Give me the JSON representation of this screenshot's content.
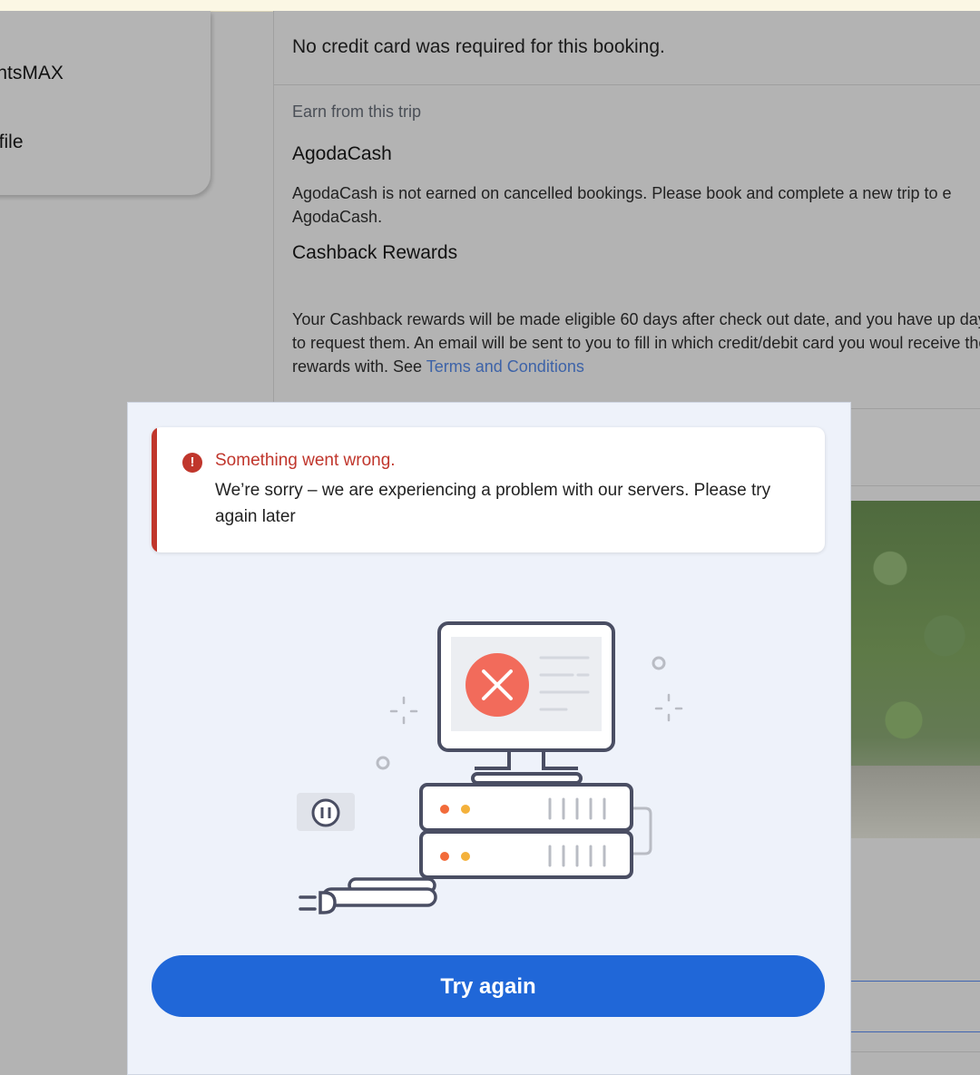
{
  "sidebar": {
    "items": [
      {
        "label": "ointsMAX"
      },
      {
        "label": "rofile"
      }
    ]
  },
  "booking": {
    "credit_card_note": "No credit card was required for this booking.",
    "earn_label": "Earn from this trip",
    "agodacash": {
      "heading": "AgodaCash",
      "text": "AgodaCash is not earned on cancelled bookings. Please book and complete a new trip to e AgodaCash."
    },
    "cashback": {
      "heading": "Cashback Rewards",
      "text": "Your Cashback rewards will be made eligible 60 days after check out date, and you have up days to request them. An email will be sent to you to fill in which credit/debit card you woul receive the rewards with. See ",
      "link": "Terms and Conditions"
    }
  },
  "modal": {
    "alert": {
      "icon": "error-info-icon",
      "title": "Something went wrong.",
      "message": "We’re sorry – we are experiencing a problem with our servers. Please try again later"
    },
    "illustration": "server-error-illustration",
    "button_label": "Try again"
  },
  "colors": {
    "overlay_bg": "#b3b3b3",
    "modal_bg": "#eef2fa",
    "error_red": "#c0362c",
    "primary_blue": "#2067d8",
    "illustration_red": "#f26b5b",
    "illustration_stroke": "#4a4e63"
  }
}
